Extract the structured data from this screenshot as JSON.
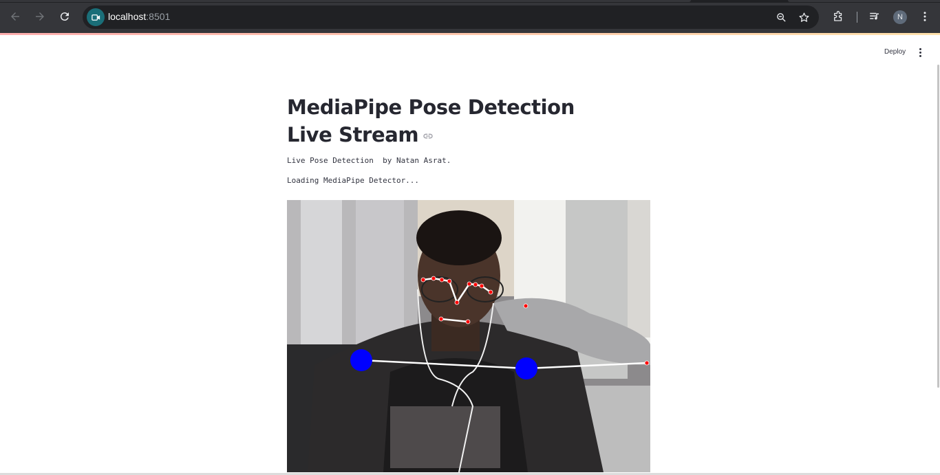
{
  "browser": {
    "url_host": "localhost",
    "url_port": ":8501",
    "profile_initial": "N",
    "icons": [
      "back-icon",
      "forward-icon",
      "reload-icon",
      "site-video-icon",
      "zoom-icon",
      "star-icon",
      "extensions-icon",
      "media-control-icon",
      "menu-icon"
    ]
  },
  "app": {
    "deploy_label": "Deploy",
    "title": "MediaPipe Pose Detection Live Stream",
    "subtitle": "Live Pose Detection  by Natan Asrat.",
    "status": "Loading MediaPipe Detector...",
    "accent_gradient": [
      "#ff4b4b",
      "#ffbd45"
    ]
  },
  "video": {
    "landmark_color": "#ff0000",
    "joint_color": "#0000ff",
    "connection_color": "#ffffff"
  }
}
